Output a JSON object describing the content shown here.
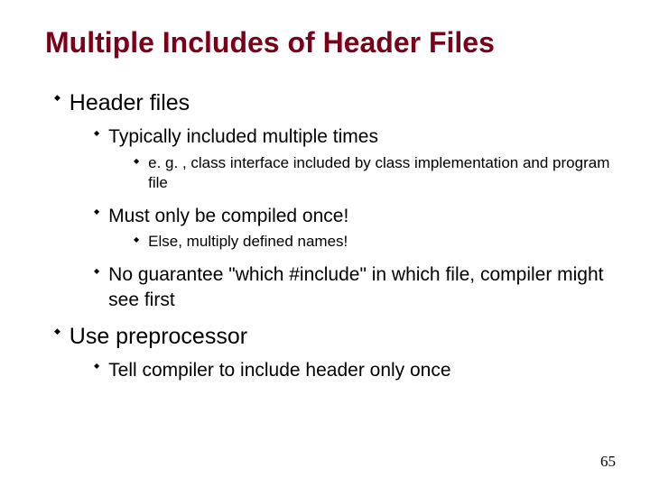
{
  "title": "Multiple Includes of Header Files",
  "page_number": "65",
  "bullets": {
    "b1": "Header files",
    "b1_1": "Typically included multiple times",
    "b1_1_1": "e. g. , class interface included by class implementation and program file",
    "b1_2": "Must only be compiled once!",
    "b1_2_1": "Else, multiply defined names!",
    "b1_3": "No guarantee \"which #include\" in which file, compiler might see first",
    "b2": "Use preprocessor",
    "b2_1": "Tell compiler to include header only once"
  }
}
